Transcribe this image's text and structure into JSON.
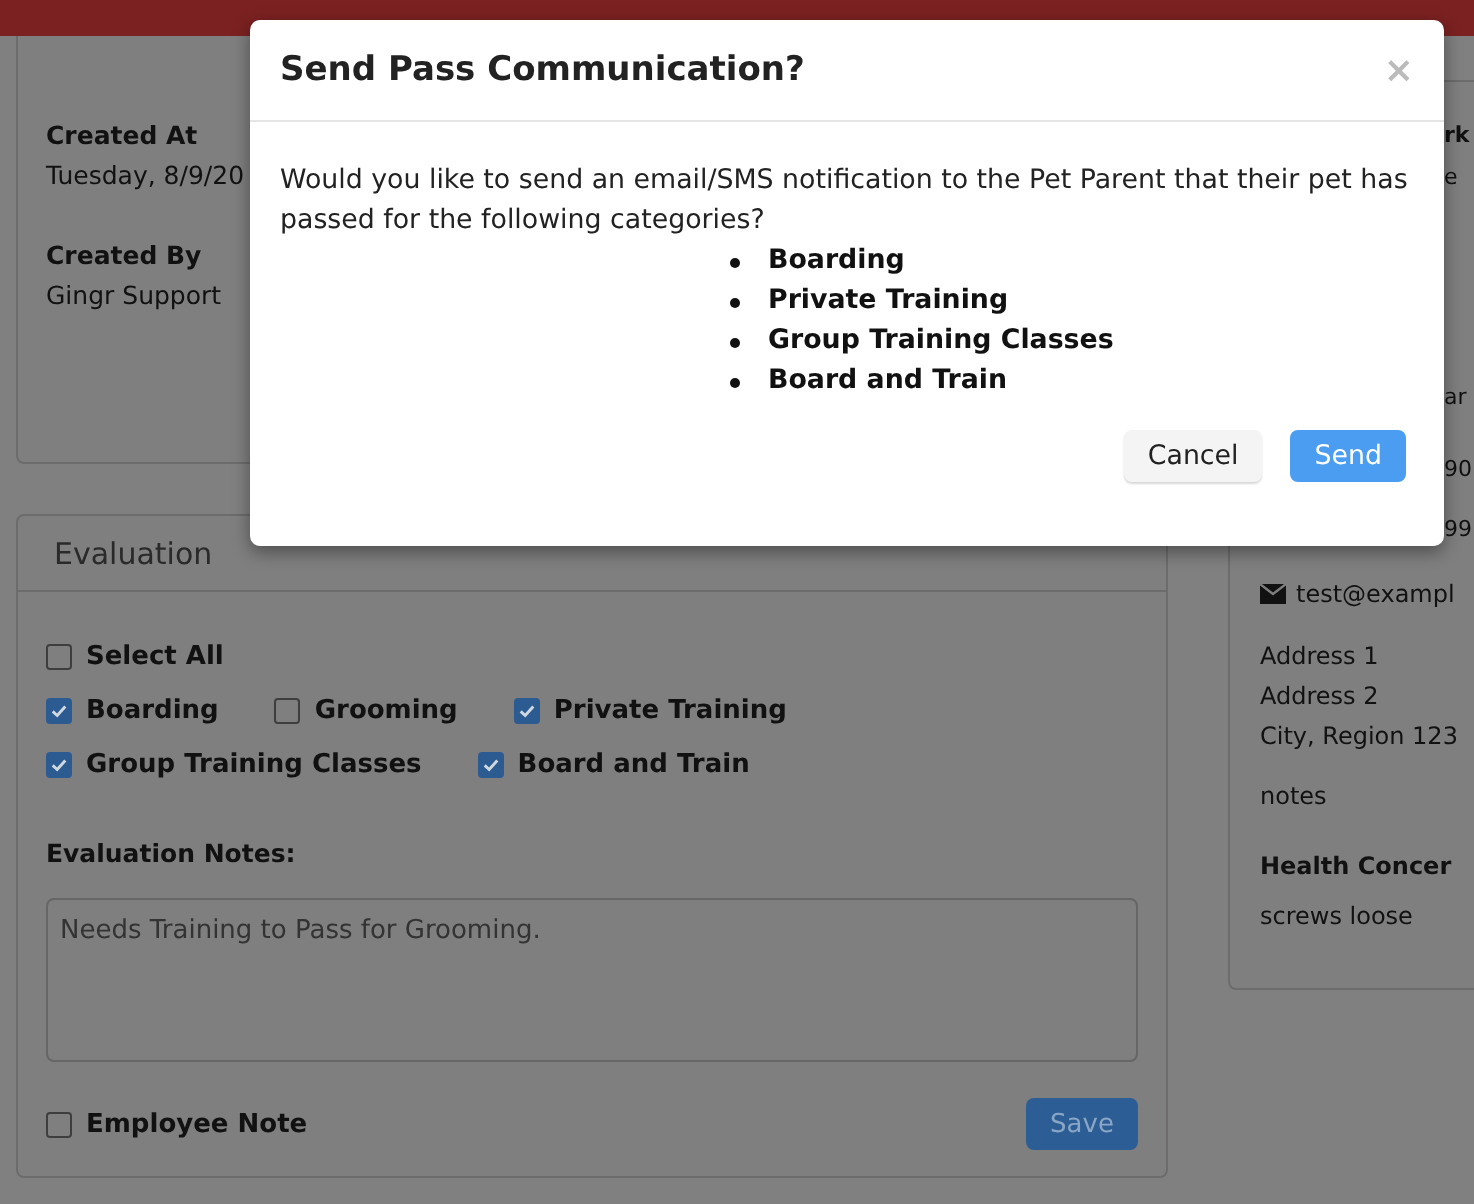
{
  "details": [
    {
      "label": "Created At",
      "value": "Tuesday, 8/9/20"
    },
    {
      "label": "Created By",
      "value": "Gingr Support"
    }
  ],
  "evaluation": {
    "title": "Evaluation",
    "select_all": {
      "label": "Select All",
      "checked": false
    },
    "categories": [
      {
        "label": "Boarding",
        "checked": true
      },
      {
        "label": "Grooming",
        "checked": false
      },
      {
        "label": "Private Training",
        "checked": true
      },
      {
        "label": "Group Training Classes",
        "checked": true
      },
      {
        "label": "Board and Train",
        "checked": true
      }
    ],
    "notes_label": "Evaluation Notes:",
    "notes": "Needs Training to Pass for Grooming.",
    "employee_note": {
      "label": "Employee Note",
      "checked": false
    },
    "save_button": "Save"
  },
  "right_panel": {
    "fragments": [
      {
        "text": "rk",
        "kind": "heading"
      },
      {
        "text": "e",
        "kind": "text"
      },
      {
        "text": "ar",
        "kind": "text"
      },
      {
        "text": "90",
        "kind": "text"
      },
      {
        "text": "99",
        "kind": "text"
      }
    ],
    "email": "test@exampl",
    "address": [
      "Address 1",
      "Address 2",
      "City, Region 123"
    ],
    "notes": "notes",
    "health_heading": "Health Concer",
    "health": "screws loose"
  },
  "modal": {
    "title": "Send Pass Communication?",
    "close": "×",
    "message": "Would you like to send an email/SMS notification to the Pet Parent that their pet has passed for the following categories?",
    "categories": [
      "Boarding",
      "Private Training",
      "Group Training Classes",
      "Board and Train"
    ],
    "buttons": [
      {
        "label": "Cancel",
        "kind": "default"
      },
      {
        "label": "Send",
        "kind": "primary"
      }
    ]
  }
}
